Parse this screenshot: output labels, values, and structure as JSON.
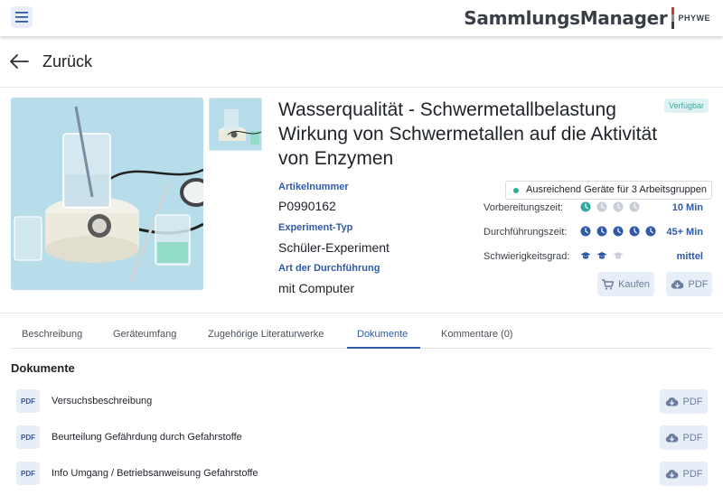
{
  "header": {
    "brand": "SammlungsManager",
    "brand_sub": "PHYWE",
    "brand_colors": [
      "#e0312b",
      "#8a8f99",
      "#3a3f47"
    ]
  },
  "nav": {
    "back_label": "Zurück"
  },
  "product": {
    "title": "Wasserqualität - Schwermetallbelastung Wirkung von Schwermetallen auf die Aktivität von Enzymen",
    "status_badge": "Verfügbar",
    "article_number_label": "Artikelnummer",
    "article_number": "P0990162",
    "experiment_type_label": "Experiment-Typ",
    "experiment_type": "Schüler-Experiment",
    "execution_label": "Art der Durchführung",
    "execution": "mit Computer",
    "stock_text": "Ausreichend Geräte für 3 Arbeitsgruppen",
    "metrics": [
      {
        "label": "Vorbereitungszeit:",
        "value": "10 Min",
        "icon": "clock-icon",
        "filled": 1,
        "total": 4
      },
      {
        "label": "Durchführungszeit:",
        "value": "45+ Min",
        "icon": "clock-icon",
        "filled": 5,
        "total": 5
      },
      {
        "label": "Schwierigkeitsgrad:",
        "value": "mittel",
        "icon": "graduation-cap-icon",
        "filled": 2,
        "total": 3
      }
    ],
    "buy_label": "Kaufen",
    "pdf_label": "PDF"
  },
  "tabs": [
    {
      "label": "Beschreibung",
      "active": false
    },
    {
      "label": "Geräteumfang",
      "active": false
    },
    {
      "label": "Zugehörige Literaturwerke",
      "active": false
    },
    {
      "label": "Dokumente",
      "active": true
    },
    {
      "label": "Kommentare (0)",
      "active": false
    }
  ],
  "documents": {
    "title": "Dokumente",
    "chip_label": "PDF",
    "items": [
      {
        "name": "Versuchsbeschreibung",
        "button": "PDF"
      },
      {
        "name": "Beurteilung Gefährdung durch Gefahrstoffe",
        "button": "PDF"
      },
      {
        "name": "Info Umgang / Betriebsanweisung Gefahrstoffe",
        "button": "PDF"
      }
    ]
  },
  "colors": {
    "accent": "#2f5aa8",
    "teal": "#33a99f",
    "chip_bg": "#e8eef8",
    "muted_icon": "#c9ced6"
  }
}
